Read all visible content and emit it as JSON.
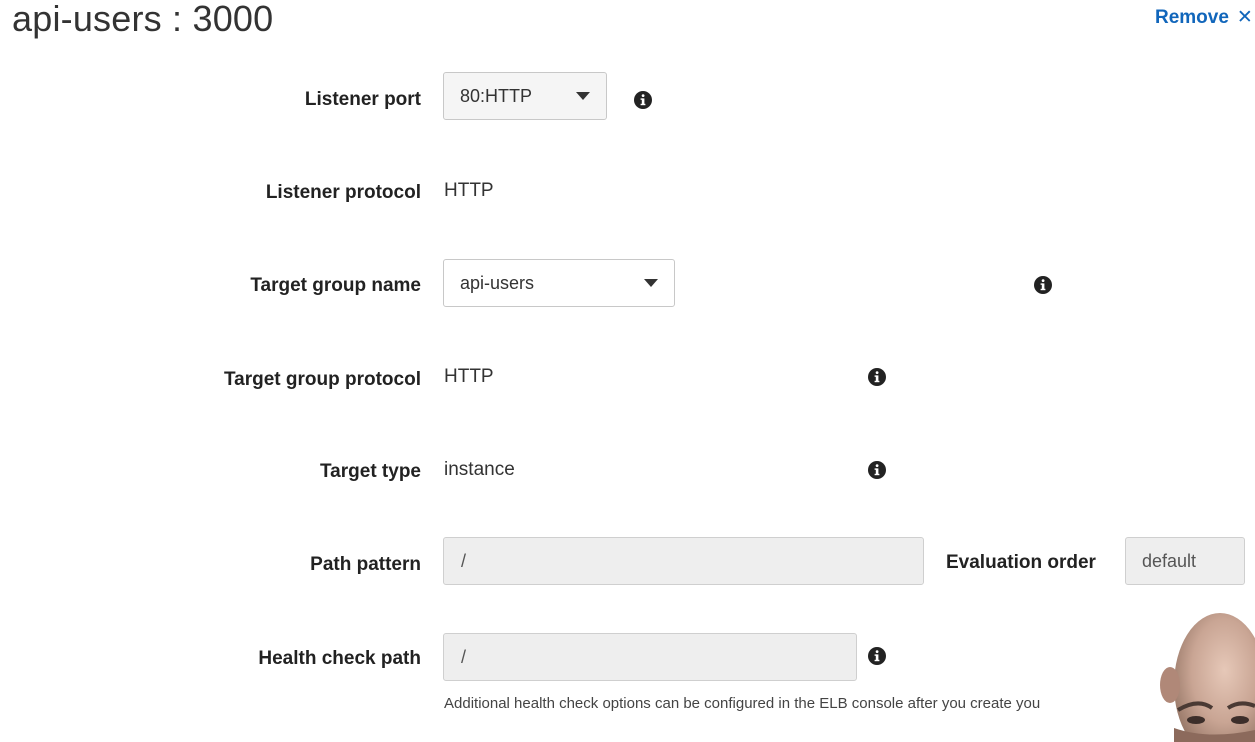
{
  "header": {
    "title": "api-users : 3000",
    "remove_label": "Remove",
    "remove_icon": "close-icon"
  },
  "form": {
    "listener_port": {
      "label": "Listener port",
      "value": "80:HTTP"
    },
    "listener_protocol": {
      "label": "Listener protocol",
      "value": "HTTP"
    },
    "target_group_name": {
      "label": "Target group name",
      "value": "api-users"
    },
    "target_group_protocol": {
      "label": "Target group protocol",
      "value": "HTTP"
    },
    "target_type": {
      "label": "Target type",
      "value": "instance"
    },
    "path_pattern": {
      "label": "Path pattern",
      "value": "/"
    },
    "evaluation_order": {
      "label": "Evaluation order",
      "value": "default"
    },
    "health_check_path": {
      "label": "Health check path",
      "value": "/",
      "help": "Additional health check options can be configured in the ELB console after you create you"
    }
  },
  "icons": {
    "info": "info-icon",
    "dropdown": "chevron-down-icon"
  },
  "colors": {
    "link": "#1166bb",
    "label": "#222222",
    "input_bg": "#eeeeee",
    "select_bg": "#f5f5f5"
  }
}
